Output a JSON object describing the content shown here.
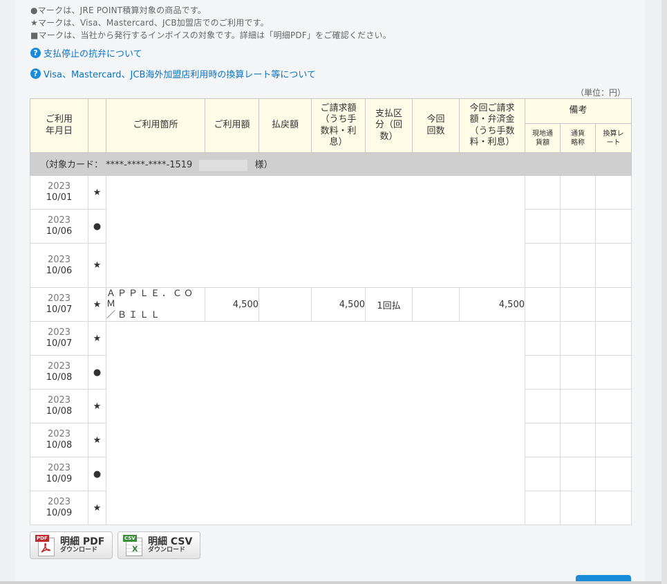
{
  "notes": [
    "●マークは、JRE POINT積算対象の商品です。",
    "★マークは、Visa、Mastercard、JCB加盟店でのご利用です。",
    "■マークは、当社から発行するインボイスの対象です。詳細は「明細PDF」をご確認ください。"
  ],
  "links": {
    "dispute": "支払停止の抗弁について",
    "exchange": "Visa、Mastercard、JCB海外加盟店利用時の換算レート等について"
  },
  "unit": "（単位：円）",
  "headers": {
    "date": "ご利用年月日",
    "place": "ご利用箇所",
    "amount": "ご利用額",
    "refund": "払戻額",
    "billed": "ご請求額（うち手数料・利息）",
    "payment_type": "支払区分（回数）",
    "this_time": "今回回数",
    "this_billed": "今回ご請求額・弁済金（うち手数料・利息）",
    "remarks": "備考",
    "local_amount": "現地通貨額",
    "currency": "通貨略称",
    "rate": "換算レート"
  },
  "card": {
    "prefix": "（対象カード：",
    "number": "****-****-****-1519",
    "suffix": "様）"
  },
  "transactions": [
    {
      "year": "2023",
      "md": "10/01",
      "mark": "★"
    },
    {
      "year": "2023",
      "md": "10/06",
      "mark": "●"
    },
    {
      "year": "2023",
      "md": "10/06",
      "mark": "★"
    },
    {
      "year": "2023",
      "md": "10/07",
      "mark": "★",
      "shop1": "ＡＰＰＬＥ．ＣＯＭ",
      "shop2": "／ＢＩＬＬ",
      "amount": "4,500",
      "billed": "4,500",
      "payment": "1回払",
      "this_billed": "4,500"
    },
    {
      "year": "2023",
      "md": "10/07",
      "mark": "★"
    },
    {
      "year": "2023",
      "md": "10/08",
      "mark": "●"
    },
    {
      "year": "2023",
      "md": "10/08",
      "mark": "★"
    },
    {
      "year": "2023",
      "md": "10/08",
      "mark": "★"
    },
    {
      "year": "2023",
      "md": "10/09",
      "mark": "●"
    },
    {
      "year": "2023",
      "md": "10/09",
      "mark": "★"
    }
  ],
  "buttons": {
    "pdf_main": "明細 PDF",
    "pdf_sub": "ダウンロード",
    "pdf_tag": "PDF",
    "csv_main": "明細 CSV",
    "csv_sub": "ダウンロード",
    "csv_tag": "CSV"
  },
  "colors": {
    "link": "#0a73c9",
    "header_bg": "#fefbe6",
    "card_row_bg": "#cfcfcf",
    "pdf_red": "#c0282d",
    "csv_green": "#3c8c3c"
  }
}
